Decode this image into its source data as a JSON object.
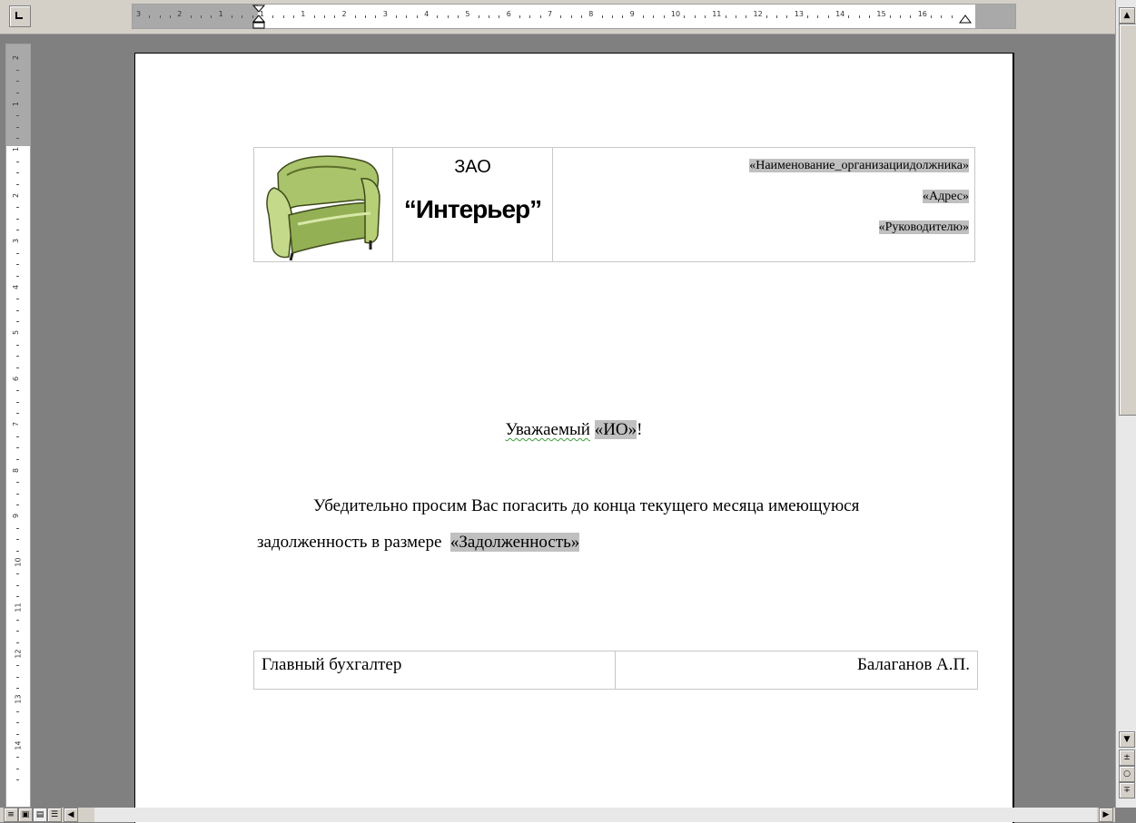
{
  "ruler": {
    "horizontal_labels": [
      "3",
      "2",
      "1",
      "1",
      "1",
      "2",
      "3",
      "4",
      "5",
      "6",
      "7",
      "8",
      "9",
      "10",
      "11",
      "12",
      "13",
      "14",
      "15",
      "16"
    ],
    "vertical_labels": [
      "2",
      "1",
      "1",
      "2",
      "3",
      "4",
      "5",
      "6",
      "7",
      "8",
      "9",
      "10",
      "11",
      "12",
      "13",
      "14"
    ]
  },
  "header": {
    "company_type": "ЗАО",
    "company_name": "“Интерьер”",
    "logo_icon": "armchair-icon",
    "fields": [
      "«Наименование_организациидолжника»",
      "«Адрес»",
      "«Руководителю»"
    ]
  },
  "letter": {
    "greeting_prefix": "Уважаемый",
    "greeting_field": "«ИО»",
    "greeting_suffix": "!",
    "body_line1": "Убедительно просим Вас погасить до конца текущего месяца имеющуюся",
    "body_line2_prefix": "задолженность в размере ",
    "body_field": "«Задолженность»"
  },
  "signature": {
    "position": "Главный бухгалтер",
    "name": "Балаганов А.П."
  },
  "colors": {
    "field_highlight": "#c0c0c0",
    "workspace": "#808080",
    "chrome": "#d4d0c8"
  }
}
